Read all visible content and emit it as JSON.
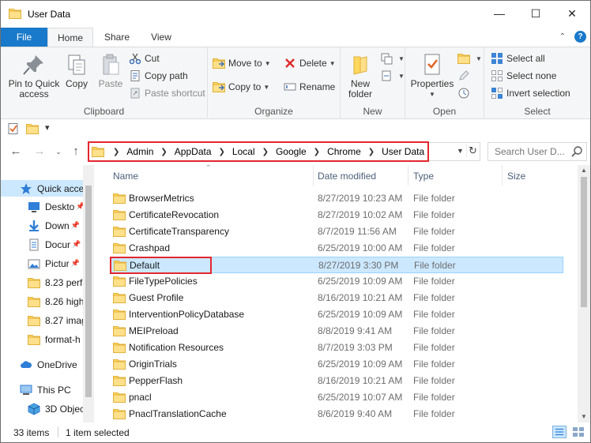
{
  "window": {
    "title": "User Data",
    "minimize_glyph": "—",
    "maximize_glyph": "☐",
    "close_glyph": "✕"
  },
  "tabs": {
    "file": "File",
    "home": "Home",
    "share": "Share",
    "view": "View"
  },
  "ribbon": {
    "clipboard": {
      "label": "Clipboard",
      "pin_line1": "Pin to Quick",
      "pin_line2": "access",
      "copy": "Copy",
      "paste": "Paste",
      "cut": "Cut",
      "copy_path": "Copy path",
      "paste_shortcut": "Paste shortcut"
    },
    "organize": {
      "label": "Organize",
      "move_to": "Move to",
      "copy_to": "Copy to",
      "delete": "Delete",
      "rename": "Rename"
    },
    "new": {
      "label": "New",
      "new_folder_line1": "New",
      "new_folder_line2": "folder"
    },
    "open": {
      "label": "Open",
      "properties": "Properties"
    },
    "select": {
      "label": "Select",
      "select_all": "Select all",
      "select_none": "Select none",
      "invert_selection": "Invert selection"
    }
  },
  "address": {
    "breadcrumbs": [
      "Admin",
      "AppData",
      "Local",
      "Google",
      "Chrome",
      "User Data"
    ],
    "search_placeholder": "Search User D..."
  },
  "nav_pane": {
    "items": [
      {
        "label": "Quick acce",
        "icon": "star-icon",
        "pinned": false,
        "selected": true
      },
      {
        "label": "Deskto",
        "icon": "desktop-icon",
        "pinned": true
      },
      {
        "label": "Down",
        "icon": "download-icon",
        "pinned": true
      },
      {
        "label": "Docur",
        "icon": "document-icon",
        "pinned": true
      },
      {
        "label": "Pictur",
        "icon": "pictures-icon",
        "pinned": true
      },
      {
        "label": "8.23 perf",
        "icon": "folder-icon"
      },
      {
        "label": "8.26 high",
        "icon": "folder-icon"
      },
      {
        "label": "8.27 imag",
        "icon": "folder-icon"
      },
      {
        "label": "format-h",
        "icon": "folder-icon"
      },
      {
        "label": "OneDrive",
        "icon": "cloud-icon"
      },
      {
        "label": "This PC",
        "icon": "computer-icon"
      },
      {
        "label": "3D Objec",
        "icon": "cube-icon"
      }
    ]
  },
  "columns": {
    "name": "Name",
    "date": "Date modified",
    "type": "Type",
    "size": "Size"
  },
  "files": [
    {
      "name": "BrowserMetrics",
      "date": "8/27/2019 10:23 AM",
      "type": "File folder"
    },
    {
      "name": "CertificateRevocation",
      "date": "8/27/2019 10:02 AM",
      "type": "File folder"
    },
    {
      "name": "CertificateTransparency",
      "date": "8/7/2019 11:56 AM",
      "type": "File folder"
    },
    {
      "name": "Crashpad",
      "date": "6/25/2019 10:00 AM",
      "type": "File folder"
    },
    {
      "name": "Default",
      "date": "8/27/2019 3:30 PM",
      "type": "File folder",
      "selected": true
    },
    {
      "name": "FileTypePolicies",
      "date": "6/25/2019 10:09 AM",
      "type": "File folder"
    },
    {
      "name": "Guest Profile",
      "date": "8/16/2019 10:21 AM",
      "type": "File folder"
    },
    {
      "name": "InterventionPolicyDatabase",
      "date": "6/25/2019 10:09 AM",
      "type": "File folder"
    },
    {
      "name": "MEIPreload",
      "date": "8/8/2019 9:41 AM",
      "type": "File folder"
    },
    {
      "name": "Notification Resources",
      "date": "8/7/2019 3:03 PM",
      "type": "File folder"
    },
    {
      "name": "OriginTrials",
      "date": "6/25/2019 10:09 AM",
      "type": "File folder"
    },
    {
      "name": "PepperFlash",
      "date": "8/16/2019 10:21 AM",
      "type": "File folder"
    },
    {
      "name": "pnacl",
      "date": "6/25/2019 10:07 AM",
      "type": "File folder"
    },
    {
      "name": "PnaclTranslationCache",
      "date": "8/6/2019 9:40 AM",
      "type": "File folder"
    }
  ],
  "status": {
    "item_count": "33 items",
    "selected_count": "1 item selected"
  },
  "colors": {
    "accent": "#1979ca",
    "selection": "#cce8ff",
    "highlight": "#e4262f",
    "folder": "#ffd75e"
  }
}
